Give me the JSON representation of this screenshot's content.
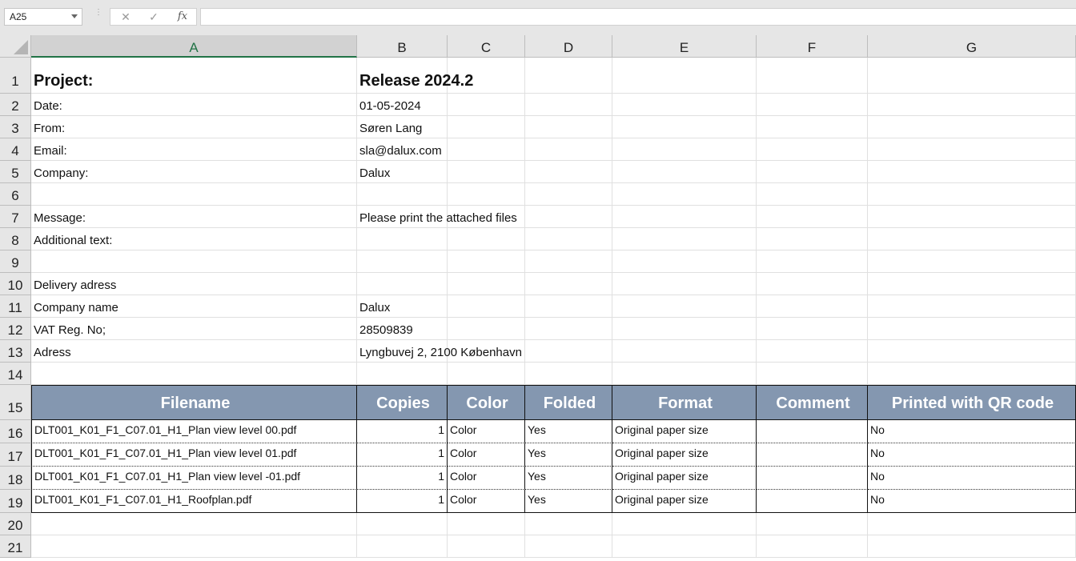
{
  "formula_bar": {
    "name_box": "A25",
    "cancel_icon": "✕",
    "enter_icon": "✓",
    "fx_label": "fx",
    "formula": ""
  },
  "columns": [
    "A",
    "B",
    "C",
    "D",
    "E",
    "F",
    "G"
  ],
  "selected_column": "A",
  "rows": [
    "1",
    "2",
    "3",
    "4",
    "5",
    "6",
    "7",
    "8",
    "9",
    "10",
    "11",
    "12",
    "13",
    "14",
    "15",
    "16",
    "17",
    "18",
    "19",
    "20",
    "21"
  ],
  "info": {
    "project_label": "Project:",
    "project_value": "Release 2024.2",
    "date_label": "Date:",
    "date_value": "01-05-2024",
    "from_label": "From:",
    "from_value": "Søren Lang",
    "email_label": "Email:",
    "email_value": "sla@dalux.com",
    "company_label": "Company:",
    "company_value": "Dalux",
    "message_label": "Message:",
    "message_value": "Please print the attached files",
    "additional_label": "Additional text:",
    "delivery_label": "Delivery adress",
    "company_name_label": "Company name",
    "company_name_value": "Dalux",
    "vat_label": "VAT Reg. No;",
    "vat_value": "28509839",
    "address_label": "Adress",
    "address_value": "Lyngbuvej 2, 2100 København"
  },
  "table": {
    "headers": [
      "Filename",
      "Copies",
      "Color",
      "Folded",
      "Format",
      "Comment",
      "Printed with QR code"
    ],
    "rows": [
      [
        "DLT001_K01_F1_C07.01_H1_Plan view level 00.pdf",
        "1",
        "Color",
        "Yes",
        "Original paper size",
        "",
        "No"
      ],
      [
        "DLT001_K01_F1_C07.01_H1_Plan view level 01.pdf",
        "1",
        "Color",
        "Yes",
        "Original paper size",
        "",
        "No"
      ],
      [
        "DLT001_K01_F1_C07.01_H1_Plan view level -01.pdf",
        "1",
        "Color",
        "Yes",
        "Original paper size",
        "",
        "No"
      ],
      [
        "DLT001_K01_F1_C07.01_H1_Roofplan.pdf",
        "1",
        "Color",
        "Yes",
        "Original paper size",
        "",
        "No"
      ]
    ]
  },
  "colors": {
    "table_header_bg": "#8497b0",
    "selected_column_accent": "#217346"
  }
}
